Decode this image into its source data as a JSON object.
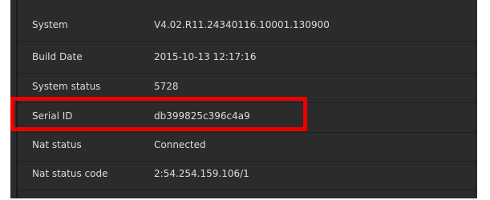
{
  "info_table": {
    "rows": [
      {
        "label": "System",
        "value": "V4.02.R11.24340116.10001.130900"
      },
      {
        "label": "Build Date",
        "value": "2015-10-13 12:17:16"
      },
      {
        "label": "System status",
        "value": "5728"
      },
      {
        "label": "Serial ID",
        "value": "db399825c396c4a9"
      },
      {
        "label": "Nat status",
        "value": "Connected"
      },
      {
        "label": "Nat status code",
        "value": "2:54.254.159.106/1"
      }
    ]
  },
  "annotation": {
    "highlight_color": "#ee0000"
  }
}
